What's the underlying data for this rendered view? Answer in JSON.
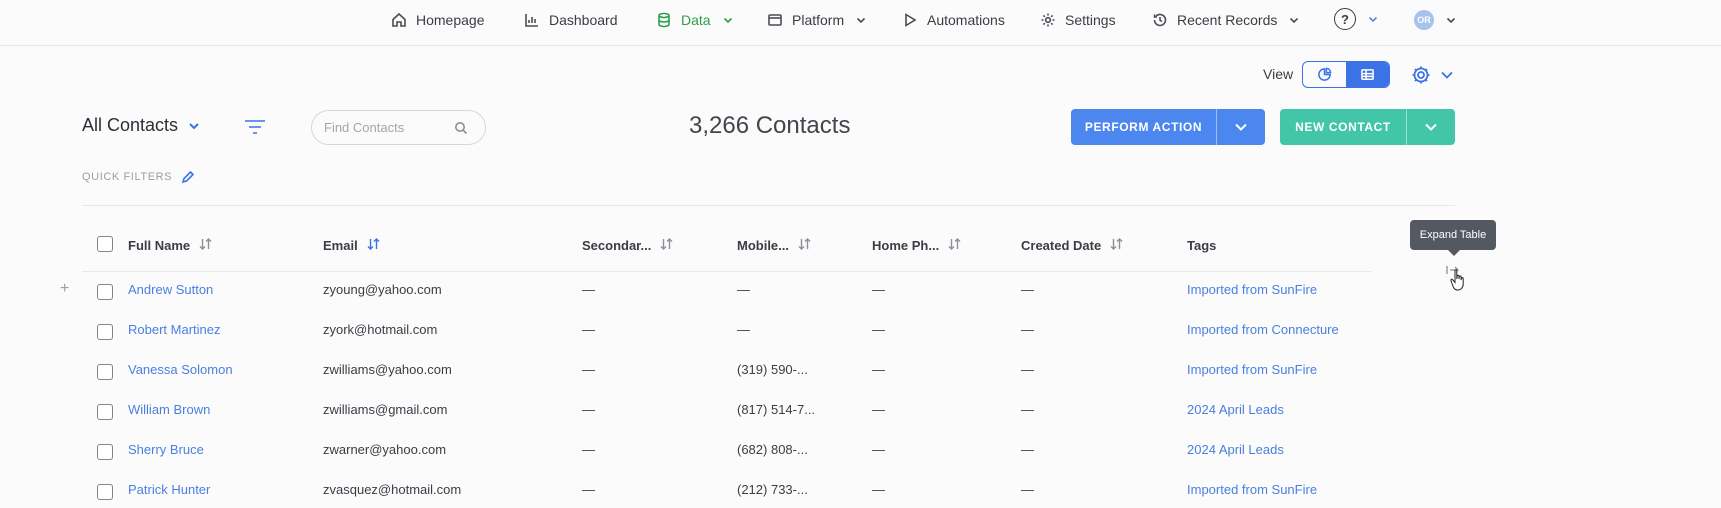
{
  "nav": {
    "items": [
      {
        "label": "Homepage",
        "icon": "home-icon"
      },
      {
        "label": "Dashboard",
        "icon": "chart-icon"
      },
      {
        "label": "Data",
        "icon": "database-icon",
        "active": true
      },
      {
        "label": "Platform",
        "icon": "window-icon"
      },
      {
        "label": "Automations",
        "icon": "play-icon"
      },
      {
        "label": "Settings",
        "icon": "gear-icon"
      },
      {
        "label": "Recent Records",
        "icon": "history-icon"
      }
    ],
    "help": "?",
    "avatar_initials": "OR",
    "active_color": "#2e9e4b"
  },
  "view": {
    "label": "View",
    "selected": "table"
  },
  "toolbar": {
    "list_name": "All Contacts",
    "search_placeholder": "Find Contacts",
    "count": "3,266 Contacts",
    "perform_action": "PERFORM ACTION",
    "new_contact": "NEW CONTACT",
    "quick_filters": "QUICK FILTERS",
    "accent": "#3b73e6",
    "action_color": "#4c87f0",
    "new_color": "#43c6a8"
  },
  "table": {
    "headers": [
      "Full Name",
      "Email",
      "Secondar...",
      "Mobile...",
      "Home Ph...",
      "Created Date",
      "Tags"
    ],
    "rows": [
      {
        "name": "Andrew Sutton",
        "email": "zyoung@yahoo.com",
        "secondary": "—",
        "mobile": "—",
        "home": "—",
        "created": "—",
        "tags": "Imported from SunFire"
      },
      {
        "name": "Robert Martinez",
        "email": "zyork@hotmail.com",
        "secondary": "—",
        "mobile": "—",
        "home": "—",
        "created": "—",
        "tags": "Imported from Connecture"
      },
      {
        "name": "Vanessa Solomon",
        "email": "zwilliams@yahoo.com",
        "secondary": "—",
        "mobile": "(319) 590-...",
        "home": "—",
        "created": "—",
        "tags": "Imported from SunFire"
      },
      {
        "name": "William Brown",
        "email": "zwilliams@gmail.com",
        "secondary": "—",
        "mobile": "(817) 514-7...",
        "home": "—",
        "created": "—",
        "tags": "2024 April Leads"
      },
      {
        "name": "Sherry Bruce",
        "email": "zwarner@yahoo.com",
        "secondary": "—",
        "mobile": "(682) 808-...",
        "home": "—",
        "created": "—",
        "tags": "2024 April Leads"
      },
      {
        "name": "Patrick Hunter",
        "email": "zvasquez@hotmail.com",
        "secondary": "—",
        "mobile": "(212) 733-...",
        "home": "—",
        "created": "—",
        "tags": "Imported from SunFire"
      }
    ]
  },
  "tooltip": "Expand Table"
}
